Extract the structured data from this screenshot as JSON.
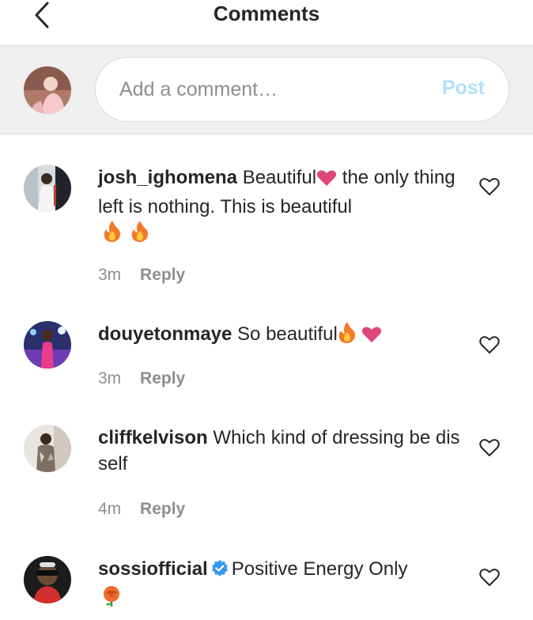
{
  "header": {
    "title": "Comments"
  },
  "composer": {
    "placeholder": "Add a comment…",
    "post_label": "Post"
  },
  "comments": [
    {
      "username": "josh_ighomena",
      "text_a": "Beautiful",
      "text_b": " the only thing left is nothing. This is beautiful",
      "time": "3m",
      "reply": "Reply"
    },
    {
      "username": "douyetonmaye",
      "text_a": "So beautiful",
      "time": "3m",
      "reply": "Reply"
    },
    {
      "username": "cliffkelvison",
      "text_a": "Which kind of dressing be dis self",
      "time": "4m",
      "reply": "Reply"
    },
    {
      "username": "sossiofficial",
      "text_a": "Positive Energy Only"
    }
  ],
  "colors": {
    "post_disabled": "#b2dffc",
    "verified": "#3897f0",
    "heart": "#e0457b",
    "fire": "#f5772a"
  },
  "icons": [
    "back-arrow-icon",
    "heart-outline-icon",
    "heart-emoji-icon",
    "fire-emoji-icon",
    "rose-emoji-icon",
    "verified-badge-icon"
  ]
}
